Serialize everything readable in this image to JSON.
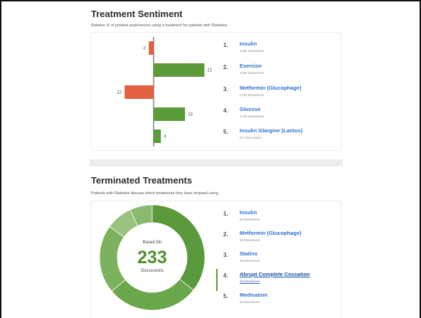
{
  "sentiment": {
    "title": "Treatment Sentiment",
    "subtitle": "Relative % of positive experiences using a treatment for patients with Diabetes.",
    "items": [
      {
        "rank": "1.",
        "name": "Insulin",
        "discussions": "3,882 Discussions"
      },
      {
        "rank": "2.",
        "name": "Exercise",
        "discussions": "2,525 Discussions"
      },
      {
        "rank": "3.",
        "name": "Metformin (Glucophage)",
        "discussions": "2,202 Discussions"
      },
      {
        "rank": "4.",
        "name": "Glucose",
        "discussions": "1,379 Discussions"
      },
      {
        "rank": "5.",
        "name": "Insulin Glargine (Lantus)",
        "discussions": "971 Discussions"
      }
    ]
  },
  "terminated": {
    "title": "Terminated Treatments",
    "subtitle": "Patients with Diabetes discuss which treatments they have stopped using.",
    "center_top": "Based On",
    "center_value": "233",
    "center_bottom": "Discussions",
    "selected_index": 3,
    "items": [
      {
        "rank": "1.",
        "name": "Insulin",
        "discussions": "83 Discussions"
      },
      {
        "rank": "2.",
        "name": "Metformin (Glucophage)",
        "discussions": "66 Discussions"
      },
      {
        "rank": "3.",
        "name": "Statins",
        "discussions": "49 Discussions"
      },
      {
        "rank": "4.",
        "name": "Abrupt Complete Cessation",
        "discussions": "19 Discussions"
      },
      {
        "rank": "5.",
        "name": "Medication",
        "discussions": "16 Discussions"
      }
    ]
  },
  "colors": {
    "positive": "#5c9a3a",
    "negative": "#e06040",
    "donut": [
      "#5a9a3c",
      "#6aa64a",
      "#7cb25e",
      "#98c27e",
      "#8aba70"
    ],
    "center_value": "#4f8f30"
  },
  "chart_data": [
    {
      "type": "bar",
      "orientation": "horizontal",
      "title": "Treatment Sentiment",
      "categories": [
        "Insulin",
        "Exercise",
        "Metformin (Glucophage)",
        "Glucose",
        "Insulin Glargine (Lantus)"
      ],
      "values": [
        -2,
        21,
        -12,
        13,
        3
      ],
      "value_labels": [
        "-2",
        "21",
        "-12",
        "13",
        "3"
      ]
    },
    {
      "type": "pie",
      "title": "Terminated Treatments",
      "categories": [
        "Insulin",
        "Metformin (Glucophage)",
        "Statins",
        "Abrupt Complete Cessation",
        "Medication"
      ],
      "values": [
        83,
        66,
        49,
        19,
        16
      ]
    }
  ]
}
